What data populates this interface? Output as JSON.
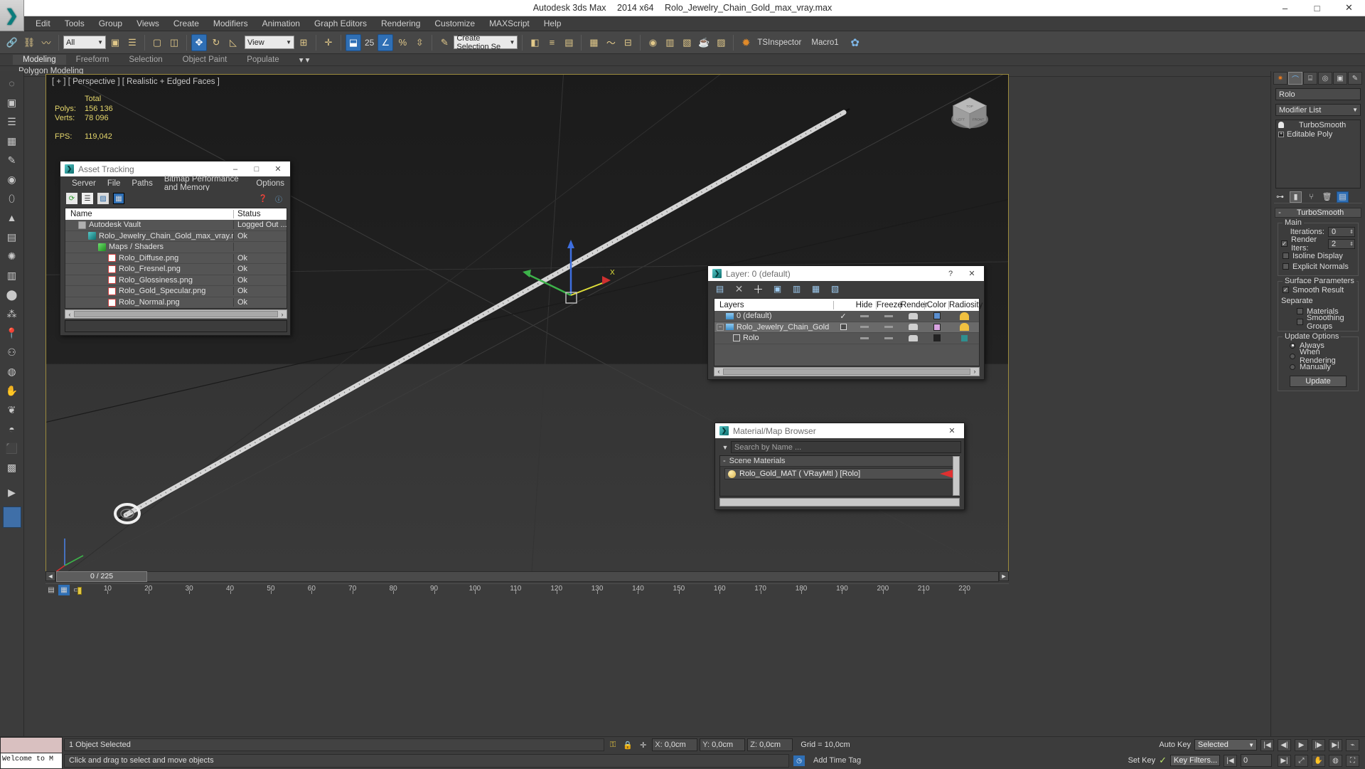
{
  "titlebar": {
    "app_name": "Autodesk 3ds Max",
    "version": "2014 x64",
    "file_name": "Rolo_Jewelry_Chain_Gold_max_vray.max",
    "minimize": "–",
    "maximize": "□",
    "close": "✕"
  },
  "menubar": {
    "items": [
      "Edit",
      "Tools",
      "Group",
      "Views",
      "Create",
      "Modifiers",
      "Animation",
      "Graph Editors",
      "Rendering",
      "Customize",
      "MAXScript",
      "Help"
    ]
  },
  "toolbar": {
    "selection_filter": "All",
    "reference_coord": "View",
    "angle_snap_value": "25",
    "named_selection_set": "Create Selection Se",
    "tsinspector": "TSInspector",
    "macro1": "Macro1"
  },
  "ribbon": {
    "tabs": [
      "Modeling",
      "Freeform",
      "Selection",
      "Object Paint",
      "Populate"
    ],
    "selected_tab": "Modeling",
    "subtab": "Polygon Modeling"
  },
  "viewport": {
    "label": "[ + ] [ Perspective ] [ Realistic + Edged Faces ]",
    "stats_header": "Total",
    "stats": [
      {
        "label": "Polys:",
        "value": "156 136"
      },
      {
        "label": "Verts:",
        "value": "78 096"
      }
    ],
    "fps_label": "FPS:",
    "fps_value": "119,042"
  },
  "asset_tracking": {
    "title": "Asset Tracking",
    "menu": [
      "Server",
      "File",
      "Paths",
      "Bitmap Performance and Memory",
      "Options"
    ],
    "columns": [
      "Name",
      "Status"
    ],
    "rows": [
      {
        "name": "Autodesk Vault",
        "status": "Logged Out ...",
        "indent": 1,
        "icon": "vault-icon"
      },
      {
        "name": "Rolo_Jewelry_Chain_Gold_max_vray.max",
        "status": "Ok",
        "indent": 2,
        "icon": "max-file-icon"
      },
      {
        "name": "Maps / Shaders",
        "status": "",
        "indent": 3,
        "icon": "maps-icon"
      },
      {
        "name": "Rolo_Diffuse.png",
        "status": "Ok",
        "indent": 4,
        "icon": "png-icon"
      },
      {
        "name": "Rolo_Fresnel.png",
        "status": "Ok",
        "indent": 4,
        "icon": "png-icon"
      },
      {
        "name": "Rolo_Glossiness.png",
        "status": "Ok",
        "indent": 4,
        "icon": "png-icon"
      },
      {
        "name": "Rolo_Gold_Specular.png",
        "status": "Ok",
        "indent": 4,
        "icon": "png-icon"
      },
      {
        "name": "Rolo_Normal.png",
        "status": "Ok",
        "indent": 4,
        "icon": "png-icon"
      }
    ]
  },
  "layer_dialog": {
    "title": "Layer: 0 (default)",
    "help_btn": "?",
    "close_btn": "✕",
    "columns": [
      "Layers",
      "",
      "Hide",
      "Freeze",
      "Render",
      "Color",
      "Radiosity"
    ],
    "rows": [
      {
        "name": "0 (default)",
        "current": "✓",
        "hide": "—",
        "freeze": "—",
        "render": "teapot",
        "color": "#5b8fd0",
        "radiosity": "on",
        "indent": 1,
        "type": "layer"
      },
      {
        "name": "Rolo_Jewelry_Chain_Gold",
        "current": "□",
        "hide": "—",
        "freeze": "—",
        "render": "teapot",
        "color": "#d8a3e0",
        "radiosity": "on",
        "indent": 1,
        "type": "layer"
      },
      {
        "name": "Rolo",
        "current": "",
        "hide": "—",
        "freeze": "—",
        "render": "teapot",
        "color": "#222222",
        "radiosity": "obj",
        "indent": 2,
        "type": "object"
      }
    ]
  },
  "material_browser": {
    "title": "Material/Map Browser",
    "close_btn": "✕",
    "search_placeholder": "Search by Name ...",
    "group_label": "Scene Materials",
    "group_toggle": "-",
    "items": [
      {
        "label": "Rolo_Gold_MAT  ( VRayMtl )  [Rolo]"
      }
    ]
  },
  "command_panel": {
    "object_name": "Rolo",
    "modifier_list": "Modifier List",
    "stack": [
      {
        "label": "TurboSmooth",
        "icon": "lightbulb-icon"
      },
      {
        "label": "Editable Poly",
        "icon": "plus-box-icon"
      }
    ],
    "rollout_title": "TurboSmooth",
    "main_group": "Main",
    "iterations_label": "Iterations:",
    "iterations_value": "0",
    "render_iters_label": "Render Iters:",
    "render_iters_value": "2",
    "render_iters_checked": true,
    "isoline_display": "Isoline Display",
    "explicit_normals": "Explicit Normals",
    "surface_parameters_group": "Surface Parameters",
    "smooth_result": "Smooth Result",
    "smooth_result_checked": true,
    "separate_label": "Separate",
    "materials": "Materials",
    "smoothing_groups": "Smoothing Groups",
    "update_options_group": "Update Options",
    "update_always": "Always",
    "update_when_rendering": "When Rendering",
    "update_manually": "Manually",
    "update_button": "Update"
  },
  "timeslider": {
    "current_frame": "0 / 225",
    "prev_arrow": "◄",
    "next_arrow": "►"
  },
  "trackbar": {
    "tick_labels": [
      "10",
      "20",
      "30",
      "40",
      "50",
      "60",
      "70",
      "80",
      "90",
      "100",
      "110",
      "120",
      "130",
      "140",
      "150",
      "160",
      "170",
      "180",
      "190",
      "200",
      "210",
      "220"
    ]
  },
  "statusbar": {
    "maxscript_prompt": "Welcome to M",
    "objects_selected": "1 Object Selected",
    "prompt": "Click and drag to select and move objects",
    "coords": [
      {
        "axis": "X:",
        "value": "0,0cm"
      },
      {
        "axis": "Y:",
        "value": "0,0cm"
      },
      {
        "axis": "Z:",
        "value": "0,0cm"
      }
    ],
    "grid": "Grid = 10,0cm",
    "auto_key": "Auto Key",
    "set_key": "Set Key",
    "selection_set": "Selected",
    "key_filters": "Key Filters...",
    "add_time_tag": "Add Time Tag",
    "key_frame_value": "0"
  },
  "colors": {
    "viewport_bg": "#1d1d1d",
    "viewport_border": "#9c8b3d",
    "panel_bg": "#3c3c3c",
    "accent_blue": "#2f6fb5",
    "stats_yellow": "#e5d66b",
    "gold_material": "#d9b24a"
  }
}
